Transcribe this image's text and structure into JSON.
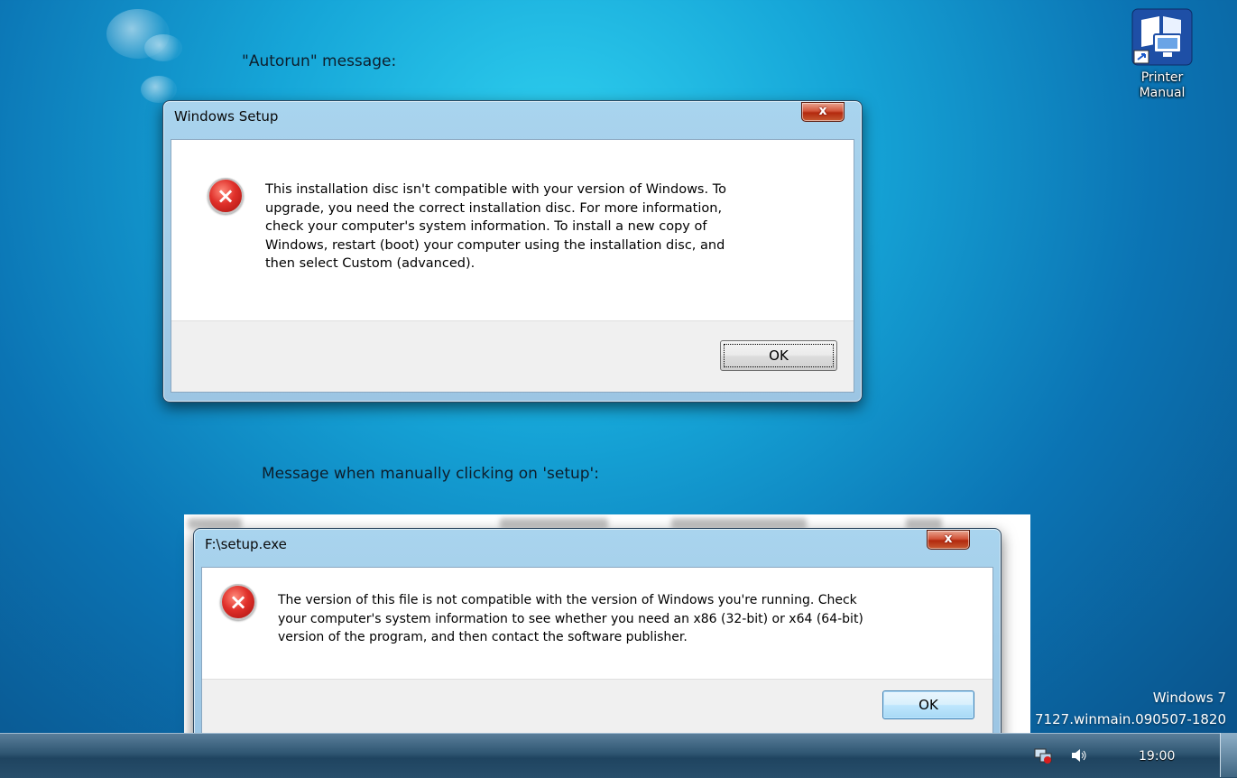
{
  "desktop": {
    "caption_autorun": "\"Autorun\" message:",
    "caption_manual": "Message when manually clicking on 'setup':",
    "icon": {
      "name": "printer-manual-icon",
      "label_line1": "Printer",
      "label_line2": "Manual"
    },
    "watermark_line1": "Windows 7",
    "watermark_line2": "7127.winmain.090507-1820"
  },
  "dialog1": {
    "title": "Windows Setup",
    "close_glyph": "x",
    "icon": "error-icon",
    "message_lines": [
      "This installation disc isn't compatible with your version of Windows. To",
      "upgrade, you need the correct installation disc. For more information,",
      "check your computer's system information. To install a new copy of",
      "Windows, restart (boot) your computer using the installation disc, and",
      "then select Custom (advanced)."
    ],
    "ok_label": "OK"
  },
  "dialog2": {
    "title": "F:\\setup.exe",
    "close_glyph": "x",
    "icon": "error-icon",
    "message_lines": [
      "The version of this file is not compatible with the version of Windows you're running. Check",
      "your computer's system information to see whether you need an x86 (32-bit) or x64 (64-bit)",
      "version of the program, and then contact the software publisher."
    ],
    "ok_label": "OK"
  },
  "taskbar": {
    "clock": "19:00",
    "tray_icons": [
      "network-icon",
      "volume-icon"
    ]
  },
  "colors": {
    "close_button": "#c4411f",
    "error_icon": "#d8251f",
    "desktop_accent": "#16a6d8"
  }
}
